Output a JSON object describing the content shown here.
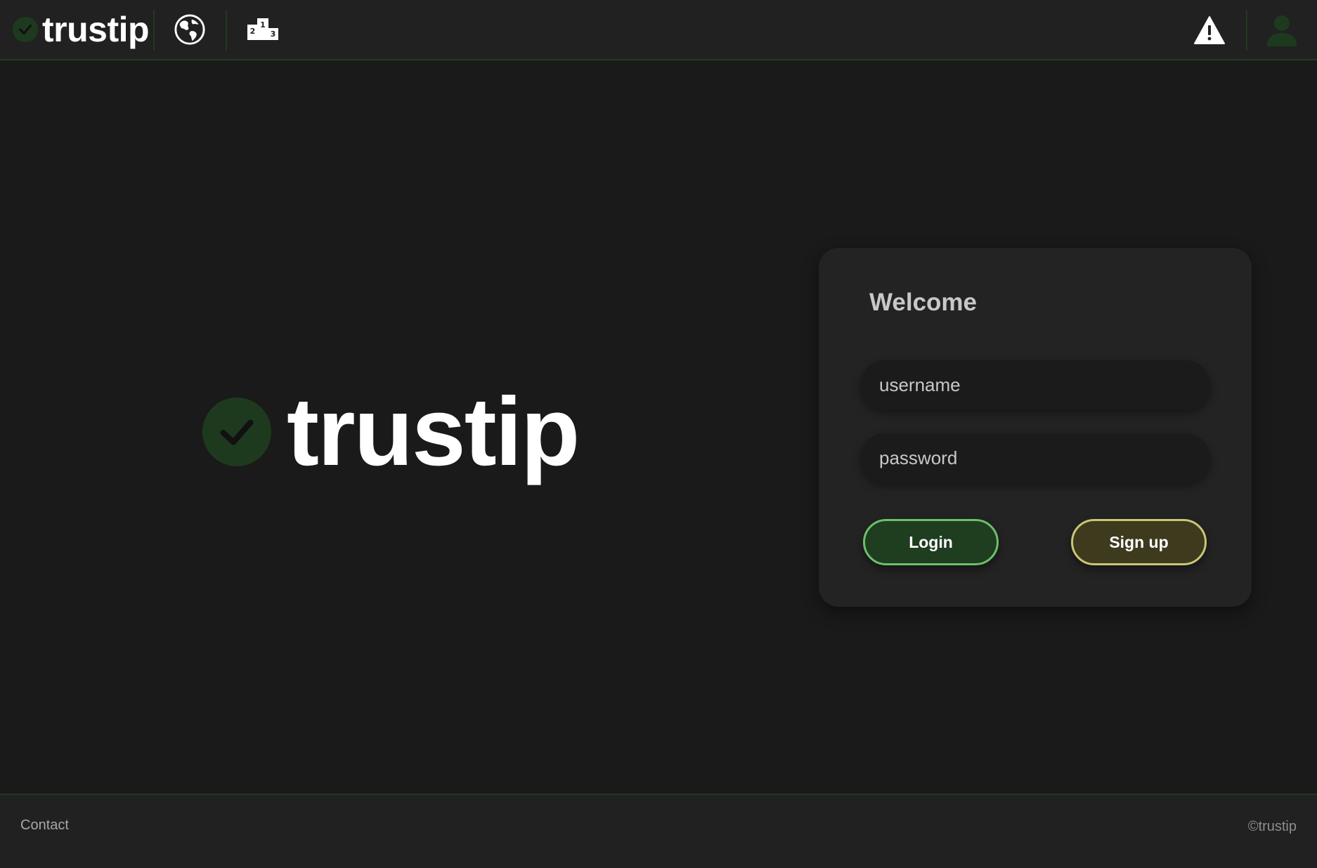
{
  "header": {
    "brand_text": "trustip",
    "icons": {
      "world": "globe-icon",
      "leaderboard": "podium-icon",
      "report": "warning-icon",
      "profile": "user-icon"
    }
  },
  "hero": {
    "logo_text": "trustip"
  },
  "login_card": {
    "title": "Welcome",
    "username_placeholder": "username",
    "password_placeholder": "password",
    "login_label": "Login",
    "signup_label": "Sign up"
  },
  "footer": {
    "contact_label": "Contact",
    "copyright": "©trustip"
  },
  "colors": {
    "background": "#1a1a1a",
    "bar": "#212121",
    "brand_green": "#1e3a1e",
    "login_border": "#6cbf6c",
    "signup_bg": "#3d3a1e",
    "signup_border": "#c9c777"
  }
}
